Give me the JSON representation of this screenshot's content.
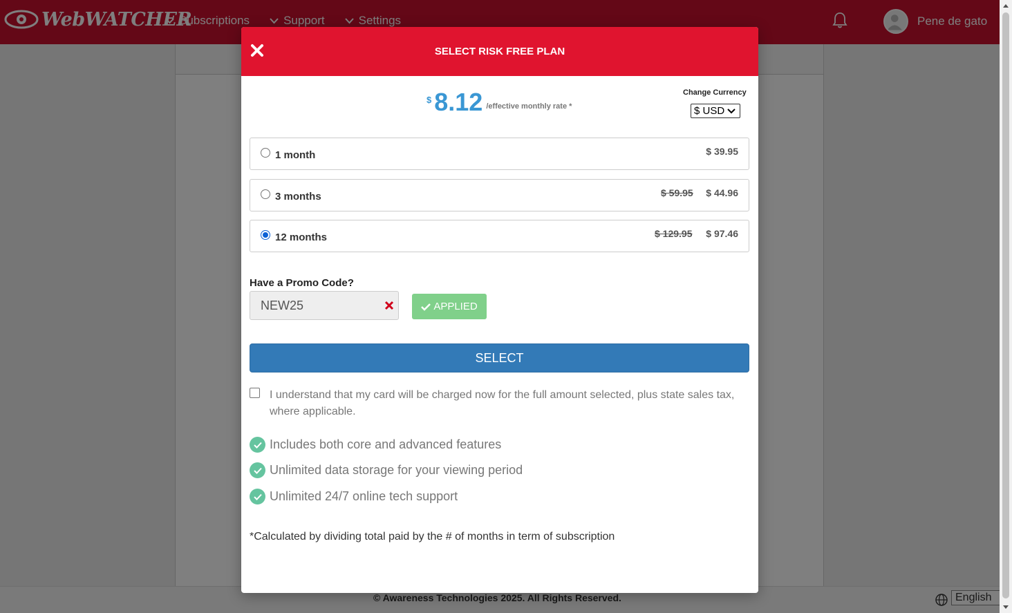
{
  "app": {
    "brand": "WebWATCHER",
    "nav": [
      {
        "label": "Subscriptions"
      },
      {
        "label": "Support"
      },
      {
        "label": "Settings"
      }
    ],
    "user_name": "Pene de gato"
  },
  "footer": {
    "copyright": "© Awareness Technologies 2025. All Rights Reserved.",
    "language": "English"
  },
  "modal": {
    "title": "SELECT RISK FREE PLAN",
    "rate_currency": "$",
    "rate_value": "8.12",
    "rate_note": "/effective monthly rate *",
    "currency_label": "Change Currency",
    "currency_value": "$ USD",
    "plans": [
      {
        "label": "1 month",
        "old_price": "",
        "price": "$ 39.95",
        "selected": false
      },
      {
        "label": "3 months",
        "old_price": "$ 59.95",
        "price": "$ 44.96",
        "selected": false
      },
      {
        "label": "12 months",
        "old_price": "$ 129.95",
        "price": "$ 97.46",
        "selected": true
      }
    ],
    "promo_label": "Have a Promo Code?",
    "promo_value": "NEW25",
    "applied_label": "APPLIED",
    "select_label": "SELECT",
    "agree_text": "I understand that my card will be charged now for the full amount selected, plus state sales tax, where applicable.",
    "features": [
      "Includes both core and advanced features",
      "Unlimited data storage for your viewing period",
      "Unlimited 24/7 online tech support"
    ],
    "footnote": "*Calculated by dividing total paid by the # of months in term of subscription"
  },
  "colors": {
    "nav_red": "#c8102e",
    "modal_header_red": "#e0142f",
    "rate_blue": "#3a97d4",
    "select_blue": "#337ab7",
    "applied_green": "#80d08a",
    "check_teal": "#65c49f"
  },
  "icons": [
    "eye-logo-icon",
    "chevron-down-icon",
    "bell-icon",
    "user-avatar-icon",
    "close-icon",
    "clear-x-icon",
    "checkmark-icon",
    "check-circle-icon",
    "globe-icon"
  ]
}
